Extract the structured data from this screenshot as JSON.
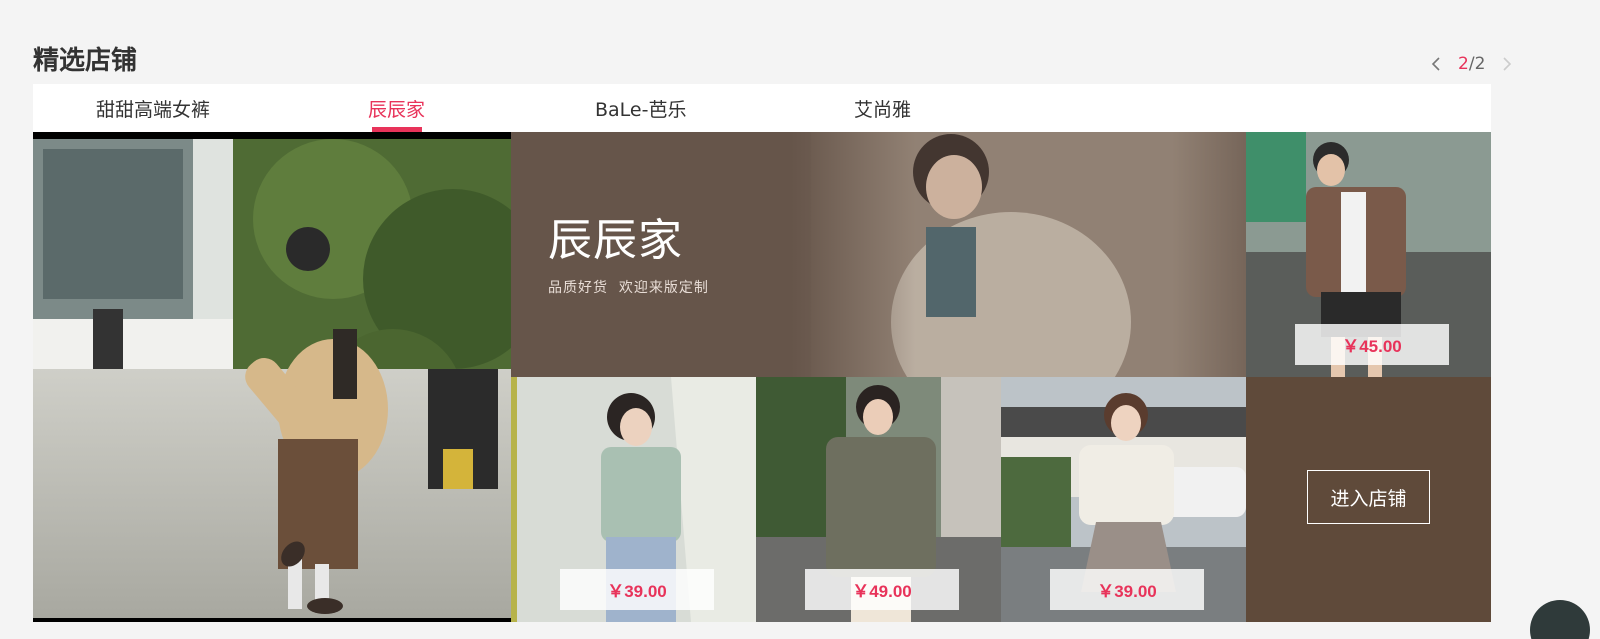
{
  "section": {
    "title": "精选店铺"
  },
  "pager": {
    "current": "2",
    "separator": "/",
    "total": "2"
  },
  "tabs": [
    {
      "label": "甜甜高端女裤",
      "active": false
    },
    {
      "label": "辰辰家",
      "active": true
    },
    {
      "label": "BaLe-芭乐",
      "active": false
    },
    {
      "label": "艾尚雅",
      "active": false
    }
  ],
  "banner": {
    "shop_name": "辰辰家",
    "slogan": "品质好货  欢迎来版定制"
  },
  "products": [
    {
      "price": "￥45.00"
    },
    {
      "price": "￥39.00"
    },
    {
      "price": "￥49.00"
    },
    {
      "price": "￥39.00"
    }
  ],
  "enter_store": {
    "label": "进入店铺"
  },
  "colors": {
    "accent": "#e8335a",
    "banner_bg": "#66554a",
    "enter_bg": "#5f4a3a"
  }
}
